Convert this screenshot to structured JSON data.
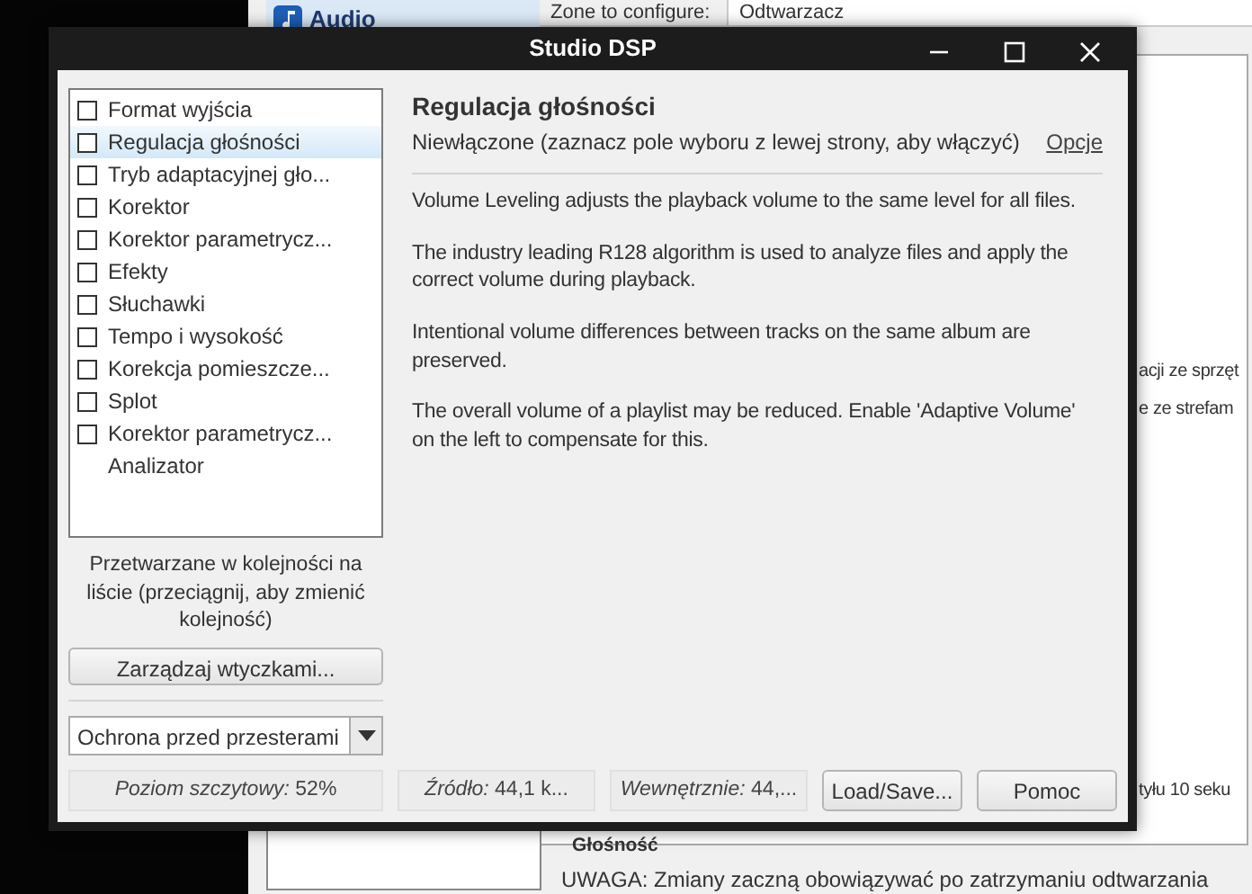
{
  "background": {
    "sidebar_item": "Audio",
    "zone_label": "Zone to configure:",
    "zone_value": "Odtwarzacz",
    "fragments": [
      "acji ze sprzęt",
      "e ze strefam",
      "tyłu 10 seku"
    ],
    "section": "Głośność",
    "note": "UWAGA: Zmiany zaczną obowiązywać po zatrzymaniu odtwarzania"
  },
  "window": {
    "title": "Studio DSP"
  },
  "plugins": [
    {
      "label": "Format wyjścia",
      "kind": "checkbox",
      "checked": false,
      "selected": false
    },
    {
      "label": "Regulacja głośności",
      "kind": "checkbox",
      "checked": false,
      "selected": true
    },
    {
      "label": "Tryb adaptacyjnej gło...",
      "kind": "checkbox",
      "checked": false,
      "selected": false
    },
    {
      "label": "Korektor",
      "kind": "checkbox",
      "checked": false,
      "selected": false
    },
    {
      "label": "Korektor parametrycz...",
      "kind": "checkbox",
      "checked": false,
      "selected": false
    },
    {
      "label": "Efekty",
      "kind": "checkbox",
      "checked": false,
      "selected": false
    },
    {
      "label": "Słuchawki",
      "kind": "checkbox",
      "checked": false,
      "selected": false
    },
    {
      "label": "Tempo i wysokość",
      "kind": "checkbox",
      "checked": false,
      "selected": false
    },
    {
      "label": "Korekcja pomieszcze...",
      "kind": "checkbox",
      "checked": false,
      "selected": false
    },
    {
      "label": "Splot",
      "kind": "checkbox",
      "checked": false,
      "selected": false
    },
    {
      "label": "Korektor parametrycz...",
      "kind": "checkbox",
      "checked": false,
      "selected": false
    },
    {
      "label": "Analizator",
      "kind": "plain",
      "selected": false
    }
  ],
  "order_hint": "Przetwarzane w kolejności na liście (przeciągnij, aby zmienić kolejność)",
  "manage_button": "Zarządzaj wtyczkami...",
  "preset": {
    "value": "Ochrona przed przesterami"
  },
  "detail": {
    "title": "Regulacja głośności",
    "subtitle": "Niewłączone (zaznacz pole wyboru z lewej strony, aby włączyć)",
    "options_link": "Opcje",
    "paragraphs": [
      "Volume Leveling adjusts the playback volume to the same level for all files.",
      "The industry leading R128 algorithm is used to analyze files and apply the correct volume during playback.",
      "Intentional volume differences between tracks on the same album are preserved.",
      "The overall volume of a playlist may be reduced.  Enable 'Adaptive Volume' on the left to compensate for this."
    ]
  },
  "status": {
    "peak": "*Poziom szczytowy:* 52%",
    "source": "*Źródło:* 44,1 k...",
    "internal": "*Wewnętrznie:* 44,..."
  },
  "buttons": [
    "Load/Save...",
    "Pomoc"
  ]
}
